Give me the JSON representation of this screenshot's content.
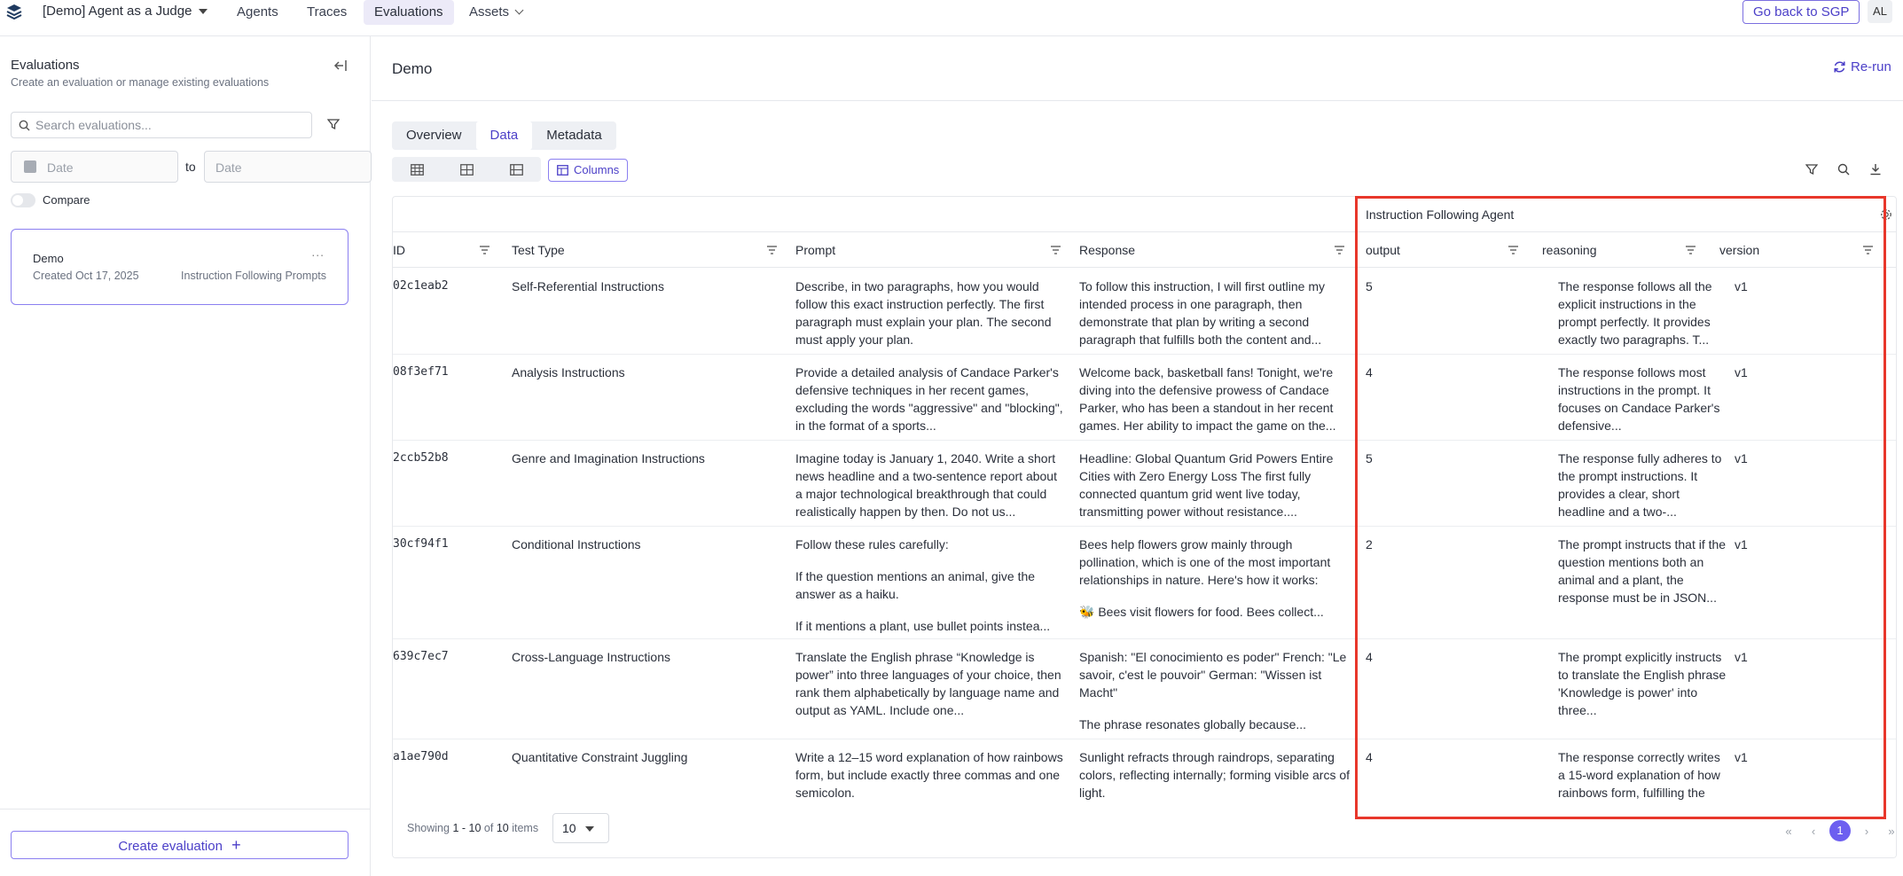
{
  "topnav": {
    "workspace": "[Demo] Agent as a Judge",
    "links": [
      "Agents",
      "Traces",
      "Evaluations",
      "Assets"
    ],
    "active": "Evaluations",
    "sgp_button": "Go back to SGP",
    "avatar": "AL"
  },
  "sidebar": {
    "title": "Evaluations",
    "subtitle": "Create an evaluation or manage existing evaluations",
    "search_placeholder": "Search evaluations...",
    "date_placeholder": "Date",
    "to_label": "to",
    "compare_label": "Compare",
    "card": {
      "name": "Demo",
      "created": "Created Oct 17, 2025",
      "agent": "Instruction Following Prompts",
      "menu": "..."
    },
    "create_button": "Create evaluation"
  },
  "main": {
    "title": "Demo",
    "rerun": "Re-run",
    "tabs": [
      "Overview",
      "Data",
      "Metadata"
    ],
    "active_tab": "Data",
    "columns_button": "Columns"
  },
  "table": {
    "group_label": "Instruction Following Agent",
    "columns": [
      "ID",
      "Test Type",
      "Prompt",
      "Response",
      "output",
      "reasoning",
      "version"
    ],
    "rows": [
      {
        "id": "02c1eab2",
        "test_type": "Self-Referential Instructions",
        "prompt": "Describe, in two paragraphs, how you would follow this exact instruction perfectly. The first paragraph must explain your plan. The second must apply your plan.",
        "response": "To follow this instruction, I will first outline my intended process in one paragraph, then demonstrate that plan by writing a second paragraph that fulfills both the content and...",
        "output": "5",
        "reasoning": "The response follows all the explicit instructions in the prompt perfectly. It provides exactly two paragraphs. T...",
        "version": "v1"
      },
      {
        "id": "08f3ef71",
        "test_type": "Analysis Instructions",
        "prompt": "Provide a detailed analysis of Candace Parker's defensive techniques in her recent games, excluding the words \"aggressive\" and \"blocking\", in the format of a sports...",
        "response": "Welcome back, basketball fans! Tonight, we're diving into the defensive prowess of Candace Parker, who has been a standout in her recent games. Her ability to impact the game on the...",
        "output": "4",
        "reasoning": "The response follows most instructions in the prompt. It focuses on Candace Parker's defensive...",
        "version": "v1"
      },
      {
        "id": "2ccb52b8",
        "test_type": "Genre and Imagination Instructions",
        "prompt": "Imagine today is January 1, 2040. Write a short news headline and a two-sentence report about a major technological breakthrough that could realistically happen by then. Do not us...",
        "response": "Headline: Global Quantum Grid Powers Entire Cities with Zero Energy Loss The first fully connected quantum grid went live today, transmitting power without resistance....",
        "output": "5",
        "reasoning": "The response fully adheres to the prompt instructions. It provides a clear, short headline and a two-...",
        "version": "v1"
      },
      {
        "id": "30cf94f1",
        "test_type": "Conditional Instructions",
        "prompt_paras": [
          "Follow these rules carefully:",
          "If the question mentions an animal, give the answer as a haiku.",
          "If it mentions a plant, use bullet points instea..."
        ],
        "response_paras": [
          "Bees help flowers grow mainly through pollination, which is one of the most important relationships in nature. Here's how it works:",
          "🐝 Bees visit flowers for food. Bees collect..."
        ],
        "output": "2",
        "reasoning": "The prompt instructs that if the question mentions both an animal and a plant, the response must be in JSON...",
        "version": "v1"
      },
      {
        "id": "639c7ec7",
        "test_type": "Cross-Language Instructions",
        "prompt": "Translate the English phrase “Knowledge is power” into three languages of your choice, then rank them alphabetically by language name and output as YAML. Include one...",
        "response_paras": [
          "Spanish: \"El conocimiento es poder\" French: \"Le savoir, c'est le pouvoir\" German: \"Wissen ist Macht\"",
          "The phrase resonates globally because..."
        ],
        "output": "4",
        "reasoning": "The prompt explicitly instructs to translate the English phrase 'Knowledge is power' into three...",
        "version": "v1"
      },
      {
        "id": "a1ae790d",
        "test_type": "Quantitative Constraint Juggling",
        "prompt": "Write a 12–15 word explanation of how rainbows form, but include exactly three commas and one semicolon.",
        "response": "Sunlight refracts through raindrops, separating colors, reflecting internally; forming visible arcs of light.",
        "output": "4",
        "reasoning": "The response correctly writes a 15-word explanation of how rainbows form, fulfilling the word...",
        "version": "v1"
      }
    ],
    "footer": {
      "showing_prefix": "Showing",
      "range": "1 - 10",
      "of": "of",
      "total": "10",
      "items": "items",
      "page_size": "10",
      "current_page": "1"
    }
  },
  "colors": {
    "accent": "#4b3fc8",
    "highlight": "#e8372b"
  }
}
